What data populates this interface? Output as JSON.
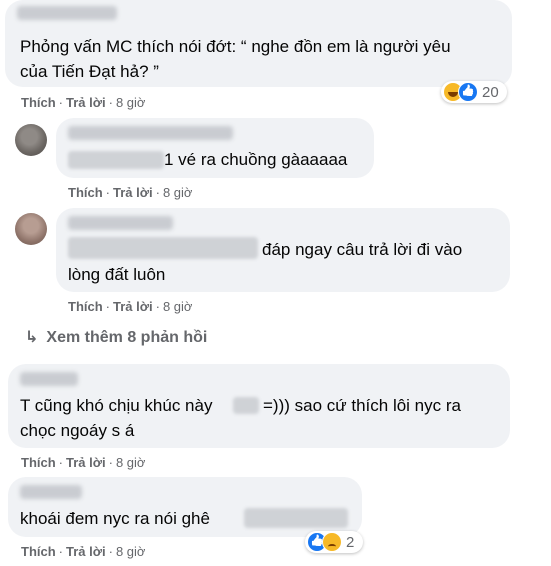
{
  "comments": [
    {
      "text_line1": "Phỏng vấn MC thích nói đớt: “ nghe đồn em là người yêu",
      "text_line2": "của Tiến Đạt hả? ”",
      "like": "Thích",
      "reply": "Trả lời",
      "time": "8 giờ",
      "reaction_count": "20",
      "reaction_icons": [
        "haha-icon",
        "like-icon"
      ]
    },
    {
      "text_line1": "1 vé ra chuồng gàaaaaa",
      "like": "Thích",
      "reply": "Trả lời",
      "time": "8 giờ"
    },
    {
      "text_line1": "đáp ngay câu trả lời đi vào",
      "text_line2": "lòng đất luôn",
      "like": "Thích",
      "reply": "Trả lời",
      "time": "8 giờ"
    },
    {
      "text_line1a": "T cũng khó chịu khúc này",
      "text_line1b": "=))) sao cứ thích lôi nyc ra",
      "text_line2": "chọc ngoáy s á",
      "like": "Thích",
      "reply": "Trả lời",
      "time": "8 giờ"
    },
    {
      "text_line1": "khoái đem nyc ra nói ghê",
      "like": "Thích",
      "reply": "Trả lời",
      "time": "8 giờ",
      "reaction_count": "2",
      "reaction_icons": [
        "like-icon",
        "sad-icon"
      ]
    }
  ],
  "view_more": {
    "arrow": "↳",
    "label": "Xem thêm 8 phản hồi"
  },
  "colors": {
    "bubble": "#f0f2f5",
    "meta_text": "#65676b",
    "like_blue": "#1877f2",
    "haha_yellow": "#f7b928"
  }
}
